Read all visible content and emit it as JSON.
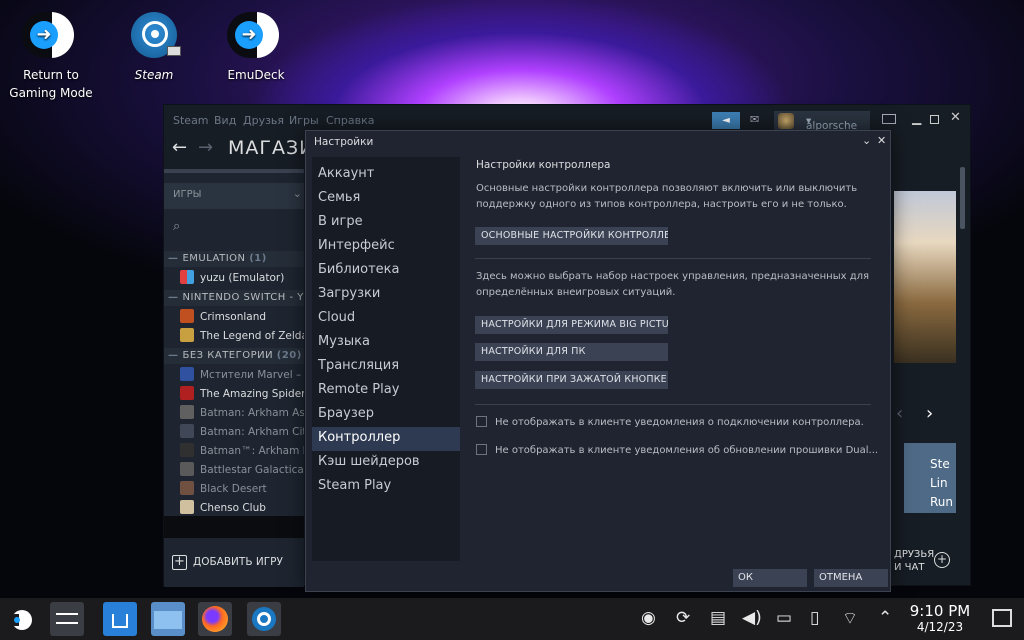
{
  "desktop": {
    "icons": [
      {
        "label1": "Return to",
        "label2": "Gaming Mode"
      },
      {
        "label1": "Steam"
      },
      {
        "label1": "EmuDeck"
      }
    ]
  },
  "steam": {
    "menu": [
      "Steam",
      "Вид",
      "Друзья",
      "Игры",
      "Справка"
    ],
    "store_title": "МАГАЗИ",
    "username": "alporsche",
    "games_filter": "ИГРЫ",
    "groups": [
      {
        "name": "EMULATION",
        "count": "(1)"
      },
      {
        "name": "NINTENDO SWITCH - YU",
        "count": ""
      },
      {
        "name": "БЕЗ КАТЕГОРИИ",
        "count": "(20)"
      }
    ],
    "emulation_items": [
      "yuzu (Emulator)"
    ],
    "switch_items": [
      "Crimsonland",
      "The Legend of Zelda:"
    ],
    "uncat_items": [
      "Мстители Marvel – De",
      "The Amazing Spider-M",
      "Batman: Arkham Asyl",
      "Batman: Arkham City",
      "Batman™: Arkham Kn",
      "Battlestar Galactica D",
      "Black Desert",
      "Chenso Club"
    ],
    "add_game": "ДОБАВИТЬ ИГРУ",
    "friends": "ДРУЗЬЯ",
    "chat": "И ЧАТ",
    "side_text": [
      "Ste",
      "Lin",
      "Run"
    ]
  },
  "settings": {
    "title": "Настройки",
    "sidebar": [
      "Аккаунт",
      "Семья",
      "В игре",
      "Интерфейс",
      "Библиотека",
      "Загрузки",
      "Cloud",
      "Музыка",
      "Трансляция",
      "Remote Play",
      "Браузер",
      "Контроллер",
      "Кэш шейдеров",
      "Steam Play"
    ],
    "active_index": 11,
    "heading": "Настройки контроллера",
    "desc1": "Основные настройки контроллера позволяют включить или выключить поддержку одного из типов контроллера, настроить его и не только.",
    "btn_general": "ОСНОВНЫЕ НАСТРОЙКИ КОНТРОЛЛЕ...",
    "desc2": "Здесь можно выбрать набор настроек управления, предназначенных для определённых внеигровых ситуаций.",
    "btn_bigpicture": "НАСТРОЙКИ ДЛЯ РЕЖИМА BIG PICTURE",
    "btn_pc": "НАСТРОЙКИ ДЛЯ ПК",
    "btn_guide": "НАСТРОЙКИ ПРИ ЗАЖАТОЙ КНОПКЕ G...",
    "chk1": "Не отображать в клиенте уведомления о подключении контроллера.",
    "chk2": "Не отображать в клиенте уведомления об обновлении прошивки Dual...",
    "ok": "ОК",
    "cancel": "ОТМЕНА"
  },
  "taskbar": {
    "time": "9:10 PM",
    "date": "4/12/23"
  }
}
